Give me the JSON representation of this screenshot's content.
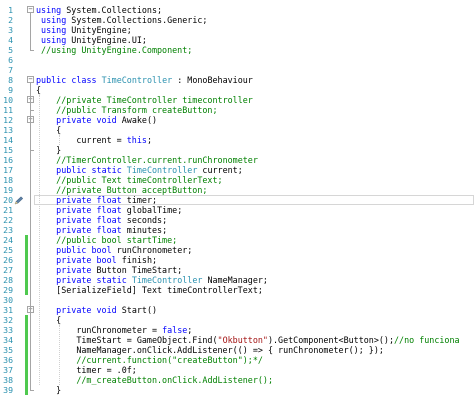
{
  "editor": {
    "language": "C#",
    "colors": {
      "keyword": "#0000ff",
      "type": "#2b91af",
      "comment": "#008000",
      "string": "#a31515",
      "line_number": "#2b91af",
      "change_bar": "#4fc94f"
    },
    "current_line": 20,
    "lines": [
      {
        "n": "1",
        "fold": "minus",
        "changed": false,
        "tokens": [
          [
            "kw",
            "using"
          ],
          [
            "tx",
            " System.Collections;"
          ]
        ]
      },
      {
        "n": "2",
        "fold": "",
        "changed": false,
        "tokens": [
          [
            "tx",
            " "
          ],
          [
            "kw",
            "using"
          ],
          [
            "tx",
            " System.Collections.Generic;"
          ]
        ]
      },
      {
        "n": "3",
        "fold": "",
        "changed": false,
        "tokens": [
          [
            "tx",
            " "
          ],
          [
            "kw",
            "using"
          ],
          [
            "tx",
            " UnityEngine;"
          ]
        ]
      },
      {
        "n": "4",
        "fold": "",
        "changed": false,
        "tokens": [
          [
            "tx",
            " "
          ],
          [
            "kw",
            "using"
          ],
          [
            "tx",
            " UnityEngine.UI;"
          ]
        ]
      },
      {
        "n": "5",
        "fold": "",
        "changed": false,
        "tokens": [
          [
            "cm",
            " //using UnityEngine.Component;"
          ]
        ]
      },
      {
        "n": "6",
        "fold": "",
        "changed": false,
        "tokens": []
      },
      {
        "n": "7",
        "fold": "",
        "changed": false,
        "tokens": []
      },
      {
        "n": "8",
        "fold": "minus",
        "changed": false,
        "tokens": [
          [
            "kw",
            "public"
          ],
          [
            "tx",
            " "
          ],
          [
            "kw",
            "class"
          ],
          [
            "tx",
            " "
          ],
          [
            "ty",
            "TimeController"
          ],
          [
            "tx",
            " : MonoBehaviour"
          ]
        ]
      },
      {
        "n": "9",
        "fold": "",
        "changed": false,
        "tokens": [
          [
            "tx",
            "{"
          ]
        ]
      },
      {
        "n": "10",
        "fold": "minus",
        "changed": false,
        "tokens": [
          [
            "tx",
            "    "
          ],
          [
            "cm",
            "//private TimeController timecontroller"
          ]
        ]
      },
      {
        "n": "11",
        "fold": "",
        "changed": false,
        "tokens": [
          [
            "tx",
            "    "
          ],
          [
            "cm",
            "//public Transform createButton;"
          ]
        ]
      },
      {
        "n": "12",
        "fold": "minus",
        "changed": false,
        "tokens": [
          [
            "tx",
            "    "
          ],
          [
            "kw",
            "private"
          ],
          [
            "tx",
            " "
          ],
          [
            "kw",
            "void"
          ],
          [
            "tx",
            " Awake()"
          ]
        ]
      },
      {
        "n": "13",
        "fold": "",
        "changed": false,
        "tokens": [
          [
            "tx",
            "    {"
          ]
        ]
      },
      {
        "n": "14",
        "fold": "",
        "changed": false,
        "tokens": [
          [
            "tx",
            "        current = "
          ],
          [
            "kw",
            "this"
          ],
          [
            "tx",
            ";"
          ]
        ]
      },
      {
        "n": "15",
        "fold": "",
        "changed": false,
        "tokens": [
          [
            "tx",
            "    }"
          ]
        ]
      },
      {
        "n": "16",
        "fold": "",
        "changed": false,
        "tokens": [
          [
            "tx",
            "    "
          ],
          [
            "cm",
            "//TimerController.current.runChronometer"
          ]
        ]
      },
      {
        "n": "17",
        "fold": "",
        "changed": false,
        "tokens": [
          [
            "tx",
            "    "
          ],
          [
            "kw",
            "public"
          ],
          [
            "tx",
            " "
          ],
          [
            "kw",
            "static"
          ],
          [
            "tx",
            " "
          ],
          [
            "ty",
            "TimeController"
          ],
          [
            "tx",
            " current;"
          ]
        ]
      },
      {
        "n": "18",
        "fold": "",
        "changed": false,
        "tokens": [
          [
            "tx",
            "    "
          ],
          [
            "cm",
            "//public Text timeControllerText;"
          ]
        ]
      },
      {
        "n": "19",
        "fold": "",
        "changed": false,
        "tokens": [
          [
            "tx",
            "    "
          ],
          [
            "cm",
            "//private Button acceptButton;"
          ]
        ]
      },
      {
        "n": "20",
        "fold": "",
        "changed": false,
        "tokens": [
          [
            "tx",
            "    "
          ],
          [
            "kw",
            "private"
          ],
          [
            "tx",
            " "
          ],
          [
            "kw",
            "float"
          ],
          [
            "tx",
            " timer;"
          ]
        ]
      },
      {
        "n": "21",
        "fold": "",
        "changed": false,
        "tokens": [
          [
            "tx",
            "    "
          ],
          [
            "kw",
            "private"
          ],
          [
            "tx",
            " "
          ],
          [
            "kw",
            "float"
          ],
          [
            "tx",
            " globalTime;"
          ]
        ]
      },
      {
        "n": "22",
        "fold": "",
        "changed": false,
        "tokens": [
          [
            "tx",
            "    "
          ],
          [
            "kw",
            "private"
          ],
          [
            "tx",
            " "
          ],
          [
            "kw",
            "float"
          ],
          [
            "tx",
            " seconds;"
          ]
        ]
      },
      {
        "n": "23",
        "fold": "",
        "changed": false,
        "tokens": [
          [
            "tx",
            "    "
          ],
          [
            "kw",
            "private"
          ],
          [
            "tx",
            " "
          ],
          [
            "kw",
            "float"
          ],
          [
            "tx",
            " minutes;"
          ]
        ]
      },
      {
        "n": "24",
        "fold": "",
        "changed": true,
        "tokens": [
          [
            "tx",
            "    "
          ],
          [
            "cm",
            "//public bool startTime;"
          ]
        ]
      },
      {
        "n": "25",
        "fold": "",
        "changed": true,
        "tokens": [
          [
            "tx",
            "    "
          ],
          [
            "kw",
            "public"
          ],
          [
            "tx",
            " "
          ],
          [
            "kw",
            "bool"
          ],
          [
            "tx",
            " runChronometer;"
          ]
        ]
      },
      {
        "n": "26",
        "fold": "",
        "changed": true,
        "tokens": [
          [
            "tx",
            "    "
          ],
          [
            "kw",
            "private"
          ],
          [
            "tx",
            " "
          ],
          [
            "kw",
            "bool"
          ],
          [
            "tx",
            " finish;"
          ]
        ]
      },
      {
        "n": "27",
        "fold": "",
        "changed": true,
        "tokens": [
          [
            "tx",
            "    "
          ],
          [
            "kw",
            "private"
          ],
          [
            "tx",
            " Button TimeStart;"
          ]
        ]
      },
      {
        "n": "28",
        "fold": "",
        "changed": true,
        "tokens": [
          [
            "tx",
            "    "
          ],
          [
            "kw",
            "private"
          ],
          [
            "tx",
            " "
          ],
          [
            "kw",
            "static"
          ],
          [
            "tx",
            " "
          ],
          [
            "ty",
            "TimeController"
          ],
          [
            "tx",
            " NameManager;"
          ]
        ]
      },
      {
        "n": "29",
        "fold": "",
        "changed": true,
        "tokens": [
          [
            "tx",
            "    [SerializeField] Text timeControllerText;"
          ]
        ]
      },
      {
        "n": "30",
        "fold": "",
        "changed": false,
        "tokens": []
      },
      {
        "n": "31",
        "fold": "minus",
        "changed": false,
        "tokens": [
          [
            "tx",
            "    "
          ],
          [
            "kw",
            "private"
          ],
          [
            "tx",
            " "
          ],
          [
            "kw",
            "void"
          ],
          [
            "tx",
            " Start()"
          ]
        ]
      },
      {
        "n": "32",
        "fold": "",
        "changed": true,
        "tokens": [
          [
            "tx",
            "    {"
          ]
        ]
      },
      {
        "n": "33",
        "fold": "",
        "changed": true,
        "tokens": [
          [
            "tx",
            "        runChronometer = "
          ],
          [
            "kw",
            "false"
          ],
          [
            "tx",
            ";"
          ]
        ]
      },
      {
        "n": "34",
        "fold": "",
        "changed": true,
        "tokens": [
          [
            "tx",
            "        TimeStart = GameObject.Find("
          ],
          [
            "st",
            "\"Okbutton\""
          ],
          [
            "tx",
            ").GetComponent<Button>();"
          ],
          [
            "cm",
            "//no funciona"
          ]
        ]
      },
      {
        "n": "35",
        "fold": "",
        "changed": true,
        "tokens": [
          [
            "tx",
            "        NameManager.onClick.AddListener(() => { runChronometer(); });"
          ]
        ]
      },
      {
        "n": "36",
        "fold": "",
        "changed": true,
        "tokens": [
          [
            "tx",
            "        "
          ],
          [
            "cm",
            "//current.function(\"createButton\");*/"
          ]
        ]
      },
      {
        "n": "37",
        "fold": "",
        "changed": true,
        "tokens": [
          [
            "tx",
            "        timer = .0f;"
          ]
        ]
      },
      {
        "n": "38",
        "fold": "",
        "changed": true,
        "tokens": [
          [
            "tx",
            "        "
          ],
          [
            "cm",
            "//m_createButton.onClick.AddListener();"
          ]
        ]
      },
      {
        "n": "39",
        "fold": "",
        "changed": true,
        "tokens": [
          [
            "tx",
            "    }"
          ]
        ]
      }
    ]
  }
}
